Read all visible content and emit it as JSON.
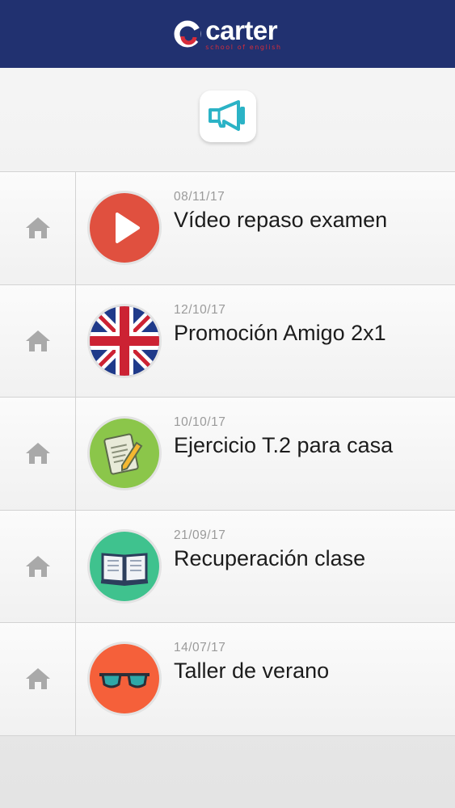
{
  "header": {
    "logo_text": "carter",
    "logo_tagline": "school of english",
    "background": "#213170"
  },
  "banner": {
    "icon": "megaphone-icon"
  },
  "items": [
    {
      "date": "08/11/17",
      "title": "Vídeo repaso examen",
      "icon": "play-icon",
      "color": "#e0503f"
    },
    {
      "date": "12/10/17",
      "title": "Promoción Amigo 2x1",
      "icon": "uk-flag-icon",
      "color": "#1f3a8a"
    },
    {
      "date": "10/10/17",
      "title": "Ejercicio T.2 para casa",
      "icon": "document-pencil-icon",
      "color": "#8bc64a"
    },
    {
      "date": "21/09/17",
      "title": "Recuperación clase",
      "icon": "book-icon",
      "color": "#3fc28e"
    },
    {
      "date": "14/07/17",
      "title": "Taller de verano",
      "icon": "sunglasses-icon",
      "color": "#f5603a"
    }
  ]
}
